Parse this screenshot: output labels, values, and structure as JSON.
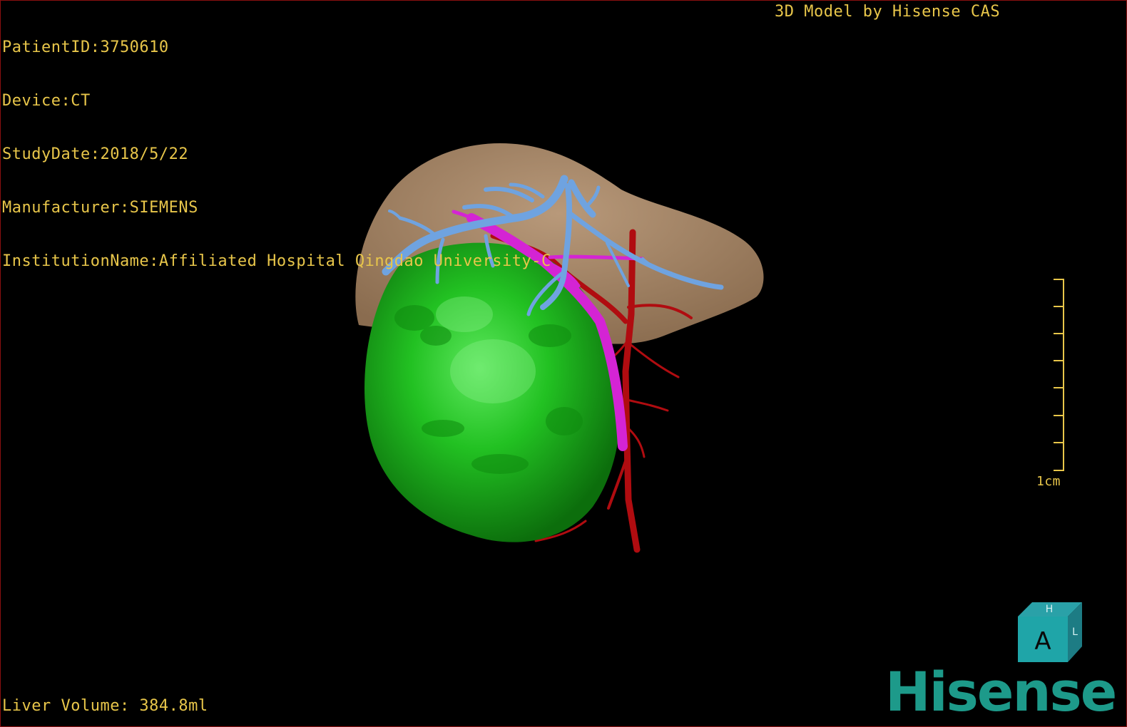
{
  "patient_info": {
    "patient_id": "PatientID:3750610",
    "device": "Device:CT",
    "study_date": "StudyDate:2018/5/22",
    "manufacturer": "Manufacturer:SIEMENS",
    "institution": "InstitutionName:Affiliated Hospital Qingdao University-C"
  },
  "credit": "3D Model by Hisense CAS",
  "volume_readout": "Liver Volume: 384.8ml",
  "scale_label": "1cm",
  "orientation_cube": {
    "front_label": "A",
    "top_label": "H",
    "side_label": "L"
  },
  "logo_text": "Hisense",
  "colors": {
    "overlay_text": "#e8c64a",
    "liver": "#a58663",
    "tumor": "#1fb81f",
    "hepatic_vein": "#6fa3e0",
    "portal_vein": "#d424d4",
    "artery": "#b00c10",
    "brand": "#1d9a8a",
    "frame": "#8a1010"
  }
}
